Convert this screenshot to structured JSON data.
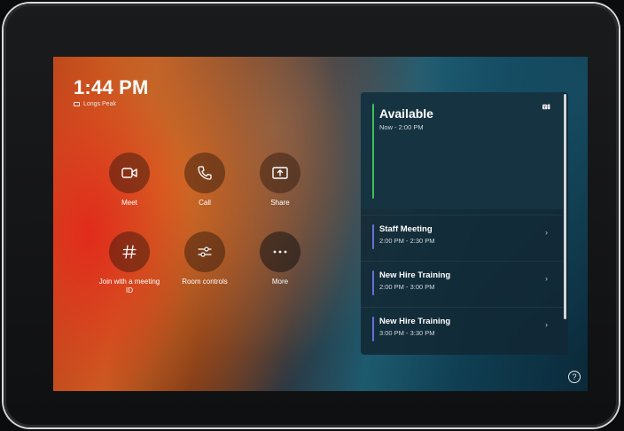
{
  "clock": {
    "time": "1:44 PM",
    "room": "Longs Peak"
  },
  "actions": [
    {
      "label": "Meet",
      "icon": "video-camera-icon"
    },
    {
      "label": "Call",
      "icon": "phone-icon"
    },
    {
      "label": "Share",
      "icon": "share-screen-icon"
    },
    {
      "label": "Join with a meeting ID",
      "icon": "hash-icon"
    },
    {
      "label": "Room controls",
      "icon": "sliders-icon"
    },
    {
      "label": "More",
      "icon": "more-icon"
    }
  ],
  "calendar": {
    "status": {
      "title": "Available",
      "time": "Now - 2:00 PM",
      "accent": "#3fbf5a"
    },
    "meetings": [
      {
        "title": "Staff Meeting",
        "time": "2:00 PM - 2:30 PM"
      },
      {
        "title": "New Hire Training",
        "time": "2:00 PM - 3:00 PM"
      },
      {
        "title": "New Hire Training",
        "time": "3:00 PM - 3:30 PM"
      }
    ],
    "meeting_accent": "#6b6fd6"
  },
  "help": {
    "label": "?"
  }
}
